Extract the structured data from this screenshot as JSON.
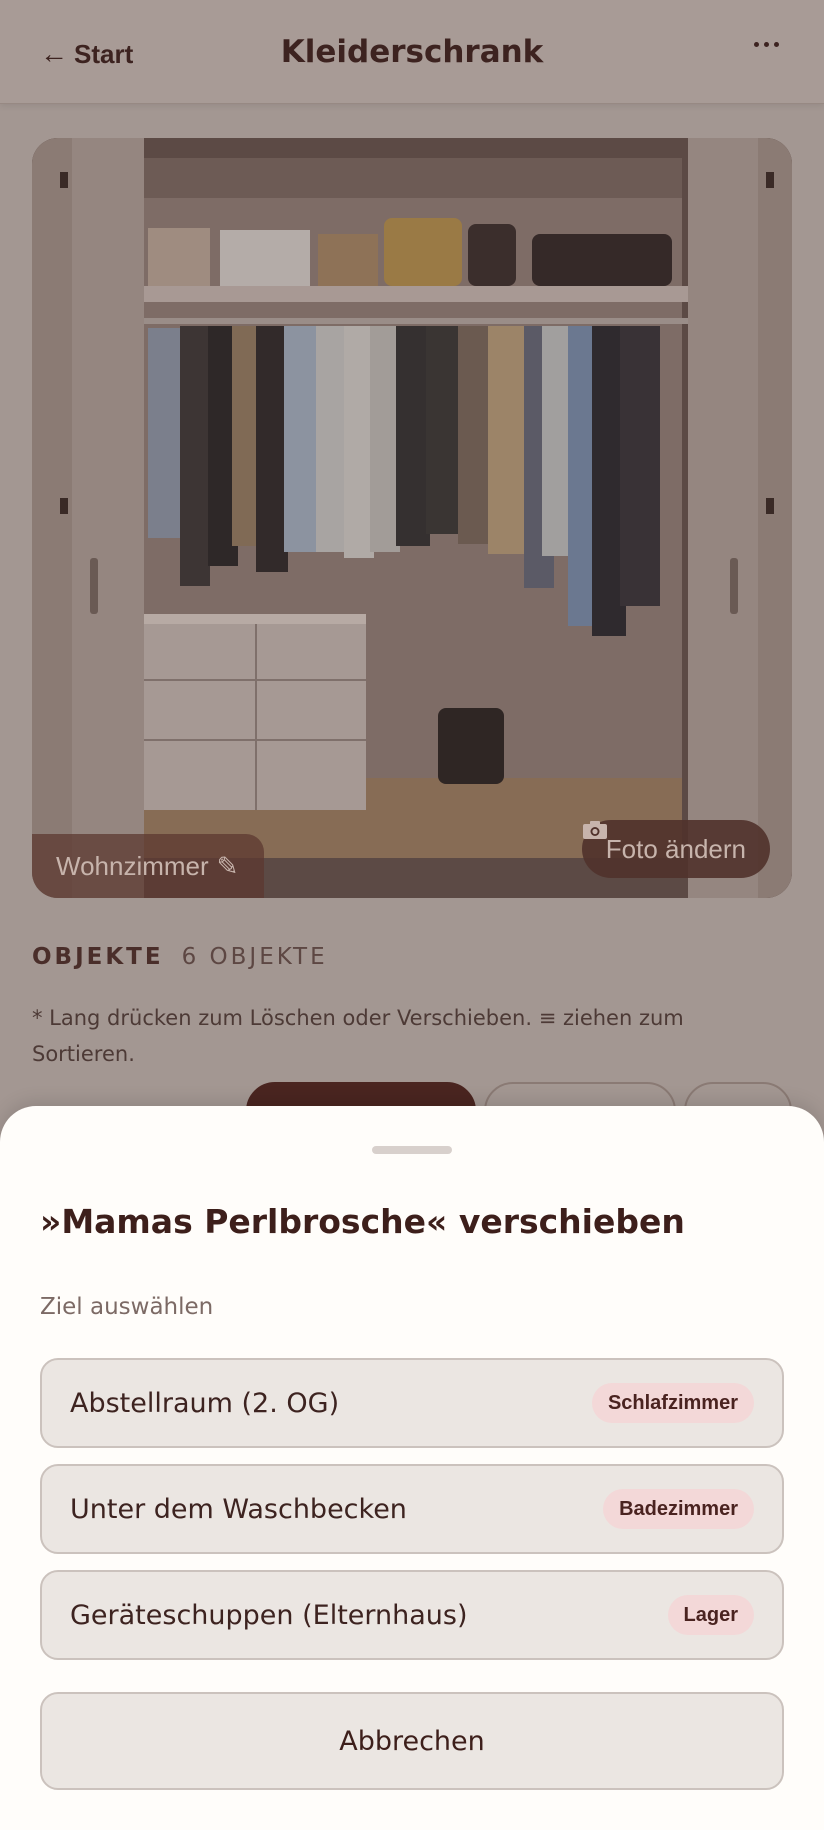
{
  "header": {
    "back_label": "Start",
    "back_icon": "arrow-left-icon",
    "title": "Kleiderschrank",
    "more_icon": "more-horizontal-icon"
  },
  "photo": {
    "room_label": "Wohnzimmer",
    "room_edit_icon": "pencil-icon",
    "change_photo_label": "Foto ändern",
    "change_photo_icon": "camera-icon"
  },
  "objects": {
    "section_label": "OBJEKTE",
    "count_label": "6 OBJEKTE",
    "hint": "* Lang drücken zum Löschen oder Verschieben. ≡ ziehen zum Sortieren."
  },
  "sheet": {
    "title": "»Mamas Perlbrosche« verschieben",
    "subtitle": "Ziel auswählen",
    "destinations": [
      {
        "name": "Abstellraum (2. OG)",
        "badge": "Schlafzimmer"
      },
      {
        "name": "Unter dem Waschbecken",
        "badge": "Badezimmer"
      },
      {
        "name": "Geräteschuppen (Elternhaus)",
        "badge": "Lager"
      }
    ],
    "cancel_label": "Abbrechen"
  },
  "colors": {
    "accent": "#4a2520",
    "scrim": "#a39792",
    "sheet_bg": "#fffdfa",
    "badge_bg": "#f3d8d8"
  }
}
